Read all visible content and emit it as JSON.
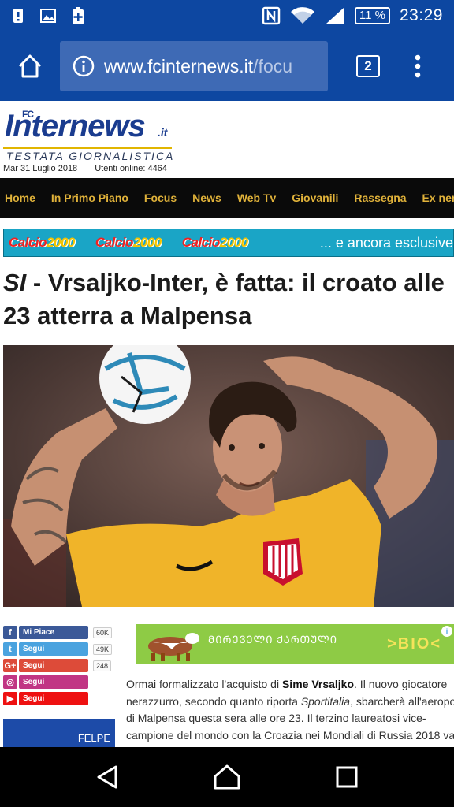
{
  "status_bar": {
    "time": "23:29",
    "battery": "11 %",
    "icons": [
      "alert-icon",
      "image-icon",
      "battery-plus-icon",
      "nfc-icon",
      "wifi-icon",
      "signal-icon"
    ]
  },
  "browser": {
    "url_host": "www.fcinternews.it",
    "url_path": "/focu",
    "tab_count": "2"
  },
  "site": {
    "logo_prefix": "FC",
    "logo_name": "Internews",
    "logo_tld": ".it",
    "logo_tagline": "TESTATA GIORNALISTICA",
    "date": "Mar 31 Luglio 2018",
    "online_users": "Utenti online: 4464"
  },
  "nav": {
    "items": [
      "Home",
      "In Primo Piano",
      "Focus",
      "News",
      "Web Tv",
      "Giovanili",
      "Rassegna",
      "Ex neraz"
    ]
  },
  "banner": {
    "logo_word": "Calcio",
    "logo_num": "2000",
    "tagline": "... e ancora esclusive"
  },
  "headline": {
    "source": "SI",
    "text": " - Vrsaljko-Inter, è fatta: il croato alle 23 atterra a Malpensa"
  },
  "social": [
    {
      "label": "Mi Piace",
      "count": "60K",
      "icon": "f",
      "color": "#3b5998",
      "icon_name": "facebook-icon"
    },
    {
      "label": "Segui",
      "count": "49K",
      "icon": "t",
      "color": "#4aa3df",
      "icon_name": "twitter-icon"
    },
    {
      "label": "Segui",
      "count": "248",
      "icon": "G+",
      "color": "#dd4b39",
      "icon_name": "googleplus-icon"
    },
    {
      "label": "Segui",
      "count": "",
      "icon": "◎",
      "color": "#c13584",
      "icon_name": "instagram-icon"
    },
    {
      "label": "Segui",
      "count": "",
      "icon": "▶",
      "color": "#ee1111",
      "icon_name": "youtube-icon"
    }
  ],
  "promo": {
    "label": "FELPE"
  },
  "ad": {
    "text": "ᲛᲘᲠᲔᲕᲔᲚᲘ ᲥᲐᲠᲗᲣᲚᲘ",
    "brand": ">BIO<",
    "badge": "i"
  },
  "article": {
    "lines": [
      {
        "parts": [
          {
            "t": "Ormai formalizzato l'acquisto di ",
            "s": ""
          },
          {
            "t": "Sime Vrsaljko",
            "s": "b"
          },
          {
            "t": ". Il nuovo giocatore",
            "s": ""
          }
        ]
      },
      {
        "parts": [
          {
            "t": "nerazzurro, secondo quanto riporta ",
            "s": ""
          },
          {
            "t": "Sportitalia",
            "s": "i"
          },
          {
            "t": ", sbarcherà all'aeropo",
            "s": ""
          }
        ]
      },
      {
        "parts": [
          {
            "t": "di Malpensa questa sera alle ore 23. Il terzino laureatosi vice-",
            "s": ""
          }
        ]
      },
      {
        "parts": [
          {
            "t": "campione del mondo con la Croazia nei Mondiali di Russia 2018 va",
            "s": ""
          }
        ]
      }
    ]
  }
}
